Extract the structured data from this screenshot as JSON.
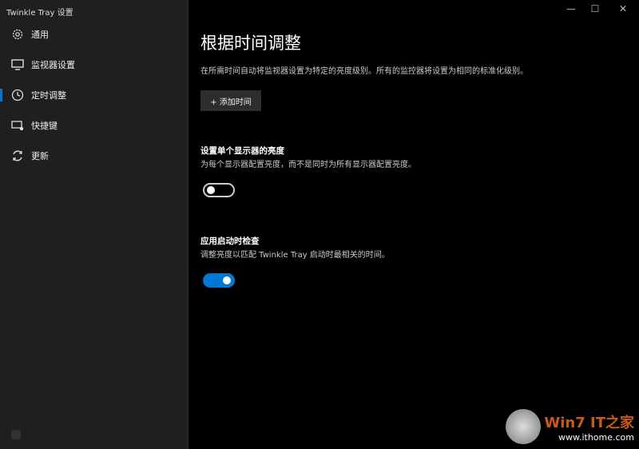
{
  "window": {
    "title": "Twinkle Tray 设置",
    "min": "—",
    "max": "☐",
    "close": "✕"
  },
  "sidebar": {
    "items": [
      {
        "label": "通用",
        "icon": "gear-icon"
      },
      {
        "label": "监视器设置",
        "icon": "monitor-icon"
      },
      {
        "label": "定时调整",
        "icon": "clock-icon",
        "active": true
      },
      {
        "label": "快捷键",
        "icon": "keyboard-icon"
      },
      {
        "label": "更新",
        "icon": "refresh-icon"
      }
    ]
  },
  "main": {
    "title": "根据时间调整",
    "description": "在所需时间自动将监视器设置为特定的亮度级别。所有的监控器将设置为相同的标准化级别。",
    "add_button": "+ 添加时间",
    "settings": [
      {
        "title": "设置单个显示器的亮度",
        "description": "为每个显示器配置亮度，而不是同时为所有显示器配置亮度。",
        "enabled": false
      },
      {
        "title": "应用启动时检查",
        "description": "调整亮度以匹配 Twinkle Tray 启动时最相关的时间。",
        "enabled": true
      }
    ]
  },
  "watermark": {
    "text": "www.ithome.com",
    "logo": "Win7 IT之家"
  }
}
